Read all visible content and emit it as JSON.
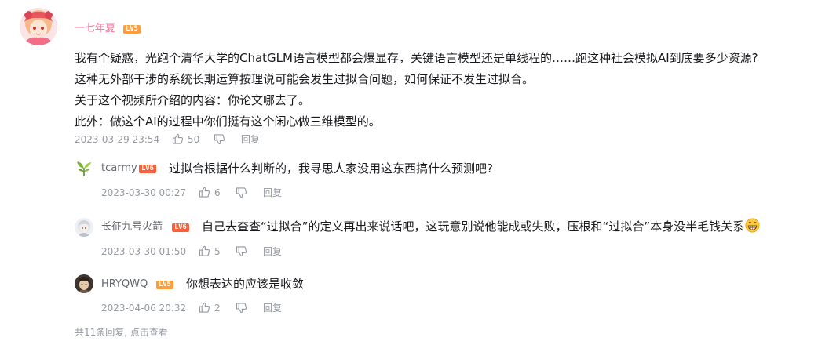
{
  "main_comment": {
    "username": "一七年夏",
    "level": "LV5",
    "lines": [
      "我有个疑惑，光跑个清华大学的ChatGLM语言模型都会爆显存，关键语言模型还是单线程的……跑这种社会模拟AI到底要多少资源?",
      "这种无外部干涉的系统长期运算按理说可能会发生过拟合问题，如何保证不发生过拟合。",
      "关于这个视频所介绍的内容：你论文哪去了。",
      "此外：做这个AI的过程中你们挺有这个闲心做三维模型的。"
    ],
    "time": "2023-03-29 23:54",
    "likes": "50",
    "reply_label": "回复"
  },
  "replies": [
    {
      "username": "tcarmy",
      "level": "LV6",
      "text": "过拟合根据什么判断的，我寻思人家没用这东西搞什么预测吧?",
      "time": "2023-03-30 00:27",
      "likes": "6",
      "reply_label": "回复"
    },
    {
      "username": "长征九号火箭",
      "level": "LV6",
      "text": "自己去查查“过拟合”的定义再出来说话吧，这玩意别说他能成或失败，压根和“过拟合”本身没半毛钱关系",
      "time": "2023-03-30 01:50",
      "likes": "5",
      "reply_label": "回复"
    },
    {
      "username": "HRYQWQ",
      "level": "LV5",
      "text": "你想表达的应该是收敛",
      "time": "2023-04-06 20:32",
      "likes": "2",
      "reply_label": "回复"
    }
  ],
  "footer": {
    "more_replies": "共11条回复, 点击查看"
  },
  "colors": {
    "username_pink": "#fb7299",
    "lv5": "#ff9c3b",
    "lv6": "#ff5c39",
    "meta_gray": "#9499a0"
  },
  "icons": {
    "like": "thumb-up-icon",
    "dislike": "thumb-down-icon",
    "emoji": "grinning-emoji-icon"
  }
}
